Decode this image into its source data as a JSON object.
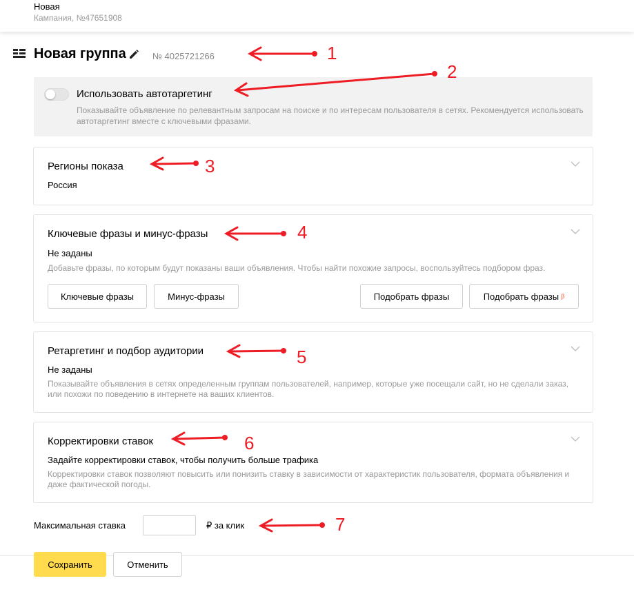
{
  "header": {
    "campaign_name": "Новая",
    "campaign_id": "Кампания, №47651908"
  },
  "group": {
    "title": "Новая группа",
    "number": "№ 4025721266"
  },
  "autotargeting": {
    "title": "Использовать автотаргетинг",
    "description": "Показывайте объявление по релевантным запросам на поиске и по интересам пользователя в сетях. Рекомендуется использовать автотаргетинг вместе с ключевыми фразами.",
    "enabled": false
  },
  "regions": {
    "title": "Регионы показа",
    "value": "Россия"
  },
  "keywords": {
    "title": "Ключевые фразы и минус-фразы",
    "value": "Не заданы",
    "hint": "Добавьте фразы, по которым будут показаны ваши объявления. Чтобы найти похожие запросы, воспользуйтесь подбором фраз.",
    "buttons": {
      "keywords": "Ключевые фразы",
      "negative": "Минус-фразы",
      "pick": "Подобрать фразы",
      "pick_beta": "Подобрать фразы",
      "beta_mark": "β"
    }
  },
  "retargeting": {
    "title": "Ретаргетинг и подбор аудитории",
    "value": "Не заданы",
    "hint": "Показывайте объявления в сетях определенным группам пользователей, например, которые уже посещали сайт, но не сделали заказ, или похожи по поведению в интернете на ваших клиентов."
  },
  "bid_adjustments": {
    "title": "Корректировки ставок",
    "value": "Задайте корректировки ставок, чтобы получить больше трафика",
    "hint": "Корректировки ставок позволяют повысить или понизить ставку в зависимости от характеристик пользователя, формата объявления и даже фактической погоды."
  },
  "max_bid": {
    "label": "Максимальная ставка",
    "value": "",
    "unit": "₽ за клик"
  },
  "actions": {
    "save": "Сохранить",
    "cancel": "Отменить"
  },
  "annotations": [
    "1",
    "2",
    "3",
    "4",
    "5",
    "6",
    "7"
  ],
  "colors": {
    "accent_yellow": "#ffdb4d",
    "annotation_red": "#ee1c25",
    "hint_gray": "#999999",
    "panel_gray": "#f2f2f2"
  }
}
